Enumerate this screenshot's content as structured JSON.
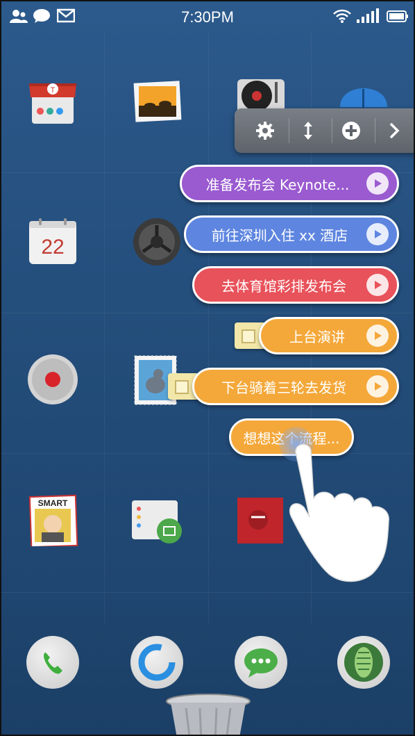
{
  "status_bar": {
    "time": "7:30PM",
    "left_icons": [
      "contacts-icon",
      "message-icon",
      "mail-icon"
    ],
    "right_icons": [
      "wifi-icon",
      "signal-icon",
      "battery-icon"
    ]
  },
  "home_icons": {
    "row1": [
      "store-app-icon",
      "gallery-app-icon",
      "music-app-icon",
      "umbrella-app-icon"
    ],
    "row2": [
      "calendar-app-icon",
      "settings-app-icon"
    ],
    "row3": [
      "recorder-app-icon",
      "stamp-app-icon"
    ],
    "row4": [
      "smart-contacts-app-icon",
      "files-app-icon",
      "news-app-icon"
    ],
    "calendar_day": "22",
    "smart_label": "SMART"
  },
  "toolbar": {
    "icons": [
      "gear-icon",
      "resize-vertical-icon",
      "add-icon",
      "chevron-right-icon"
    ]
  },
  "tasks": [
    {
      "label": "准备发布会 Keynote...",
      "color": "#9a5ad0"
    },
    {
      "label": "前往深圳入住 xx 酒店",
      "color": "#5e86e0"
    },
    {
      "label": "去体育馆彩排发布会",
      "color": "#e8525a"
    },
    {
      "label": "上台演讲",
      "color": "#f4a83a"
    },
    {
      "label": "下台骑着三轮去发货",
      "color": "#f4a83a"
    }
  ],
  "new_task_bubble": {
    "text": "想想这个流程..."
  },
  "dock": {
    "icons": [
      "phone-icon",
      "browser-icon",
      "chat-icon",
      "camera-icon"
    ]
  },
  "trash_icon": "trash-icon"
}
